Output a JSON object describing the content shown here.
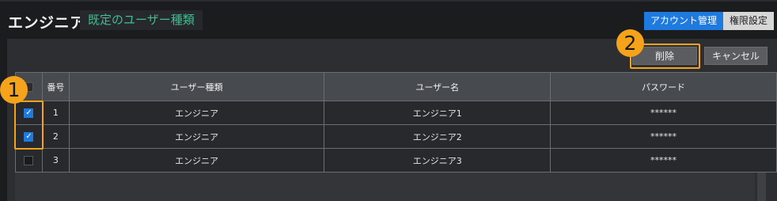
{
  "header": {
    "title": "エンジニア",
    "badge": "既定のユーザー種類",
    "tabs": [
      {
        "label": "アカウント管理",
        "active": true
      },
      {
        "label": "権限設定",
        "active": false
      }
    ]
  },
  "toolbar": {
    "delete_label": "削除",
    "cancel_label": "キャンセル"
  },
  "callouts": [
    "1",
    "2"
  ],
  "table": {
    "columns": [
      "",
      "番号",
      "ユーザー種類",
      "ユーザー名",
      "パスワード"
    ],
    "rows": [
      {
        "checked": true,
        "number": "1",
        "type": "エンジニア",
        "username": "エンジニア1",
        "password": "******"
      },
      {
        "checked": true,
        "number": "2",
        "type": "エンジニア",
        "username": "エンジニア2",
        "password": "******"
      },
      {
        "checked": false,
        "number": "3",
        "type": "エンジニア",
        "username": "エンジニア3",
        "password": "******"
      }
    ]
  },
  "colors": {
    "accent": "#1f7ae0",
    "highlight": "#f5a31a",
    "badge_text": "#3fbf8f"
  }
}
